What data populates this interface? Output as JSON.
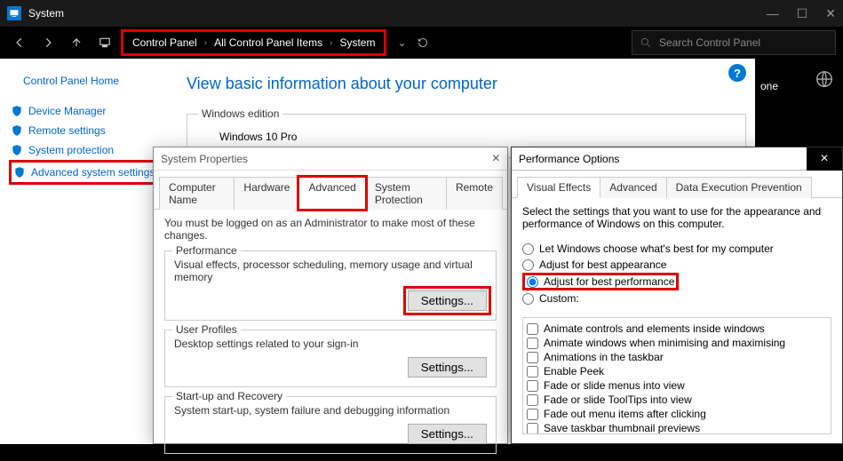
{
  "titlebar": {
    "title": "System"
  },
  "breadcrumb": {
    "items": [
      "Control Panel",
      "All Control Panel Items",
      "System"
    ]
  },
  "search": {
    "placeholder": "Search Control Panel"
  },
  "darkside": {
    "one": "one"
  },
  "sidebar": {
    "home": "Control Panel Home",
    "items": [
      {
        "label": "Device Manager"
      },
      {
        "label": "Remote settings"
      },
      {
        "label": "System protection"
      },
      {
        "label": "Advanced system settings"
      }
    ]
  },
  "page": {
    "title": "View basic information about your computer",
    "edition_legend": "Windows edition",
    "edition_value": "Windows 10 Pro"
  },
  "sysprops": {
    "title": "System Properties",
    "tabs": [
      "Computer Name",
      "Hardware",
      "Advanced",
      "System Protection",
      "Remote"
    ],
    "admin_note": "You must be logged on as an Administrator to make most of these changes.",
    "perf": {
      "legend": "Performance",
      "desc": "Visual effects, processor scheduling, memory usage and virtual memory",
      "btn": "Settings..."
    },
    "profiles": {
      "legend": "User Profiles",
      "desc": "Desktop settings related to your sign-in",
      "btn": "Settings..."
    },
    "startup": {
      "legend": "Start-up and Recovery",
      "desc": "System start-up, system failure and debugging information",
      "btn": "Settings..."
    }
  },
  "perfopts": {
    "title": "Performance Options",
    "tabs": [
      "Visual Effects",
      "Advanced",
      "Data Execution Prevention"
    ],
    "intro": "Select the settings that you want to use for the appearance and performance of Windows on this computer.",
    "radios": [
      "Let Windows choose what's best for my computer",
      "Adjust for best appearance",
      "Adjust for best performance",
      "Custom:"
    ],
    "selected_radio": 2,
    "checks": [
      "Animate controls and elements inside windows",
      "Animate windows when minimising and maximising",
      "Animations in the taskbar",
      "Enable Peek",
      "Fade or slide menus into view",
      "Fade or slide ToolTips into view",
      "Fade out menu items after clicking",
      "Save taskbar thumbnail previews"
    ]
  }
}
